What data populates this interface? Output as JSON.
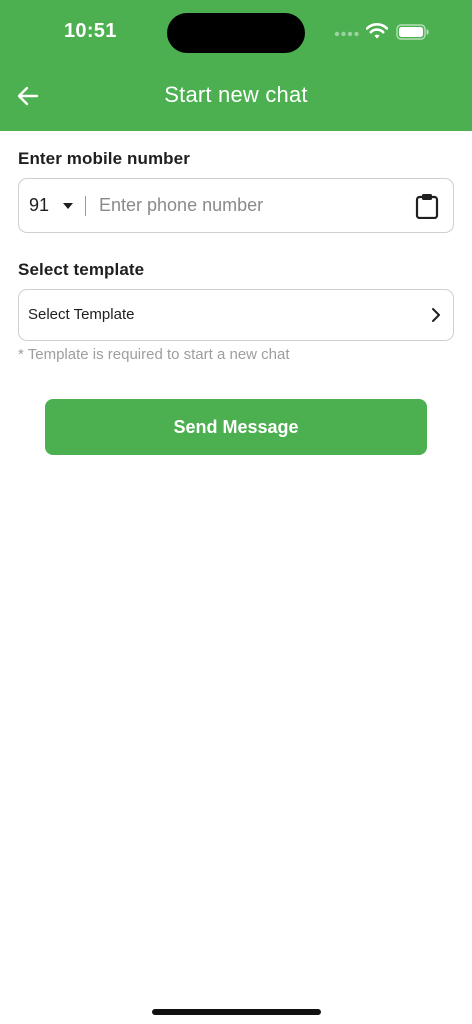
{
  "status_bar": {
    "time": "10:51",
    "icons": [
      "signal-icon",
      "wifi-icon",
      "battery-icon"
    ]
  },
  "header": {
    "title": "Start new chat",
    "back_icon": "arrow-left-icon",
    "background": "#4caf50"
  },
  "mobile": {
    "label": "Enter mobile number",
    "country_code": "91",
    "phone_placeholder": "Enter phone number",
    "phone_value": "",
    "paste_icon": "clipboard-icon"
  },
  "template": {
    "label": "Select template",
    "selector_text": "Select Template",
    "hint": "* Template is required to start a new chat",
    "chevron_icon": "chevron-right-icon"
  },
  "actions": {
    "send_label": "Send Message"
  },
  "colors": {
    "accent": "#4caf50",
    "border": "#cfcfcf",
    "hint_text": "#9e9e9e"
  }
}
